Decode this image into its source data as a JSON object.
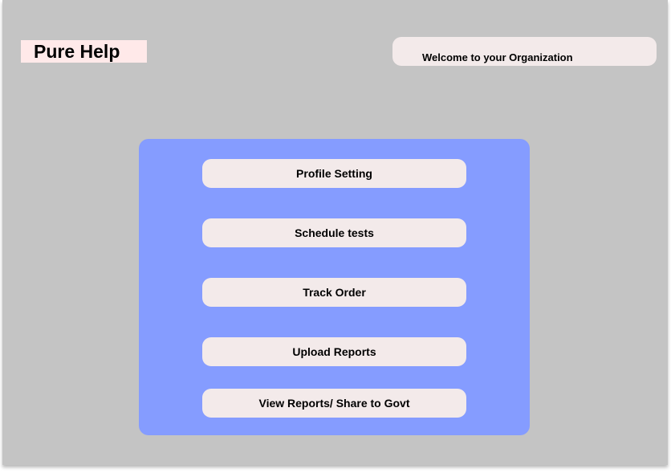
{
  "app": {
    "brand": "Pure Help",
    "welcome_text": "Welcome to your Organization"
  },
  "menu": {
    "items": [
      {
        "label": "Profile Setting"
      },
      {
        "label": "Schedule tests"
      },
      {
        "label": "Track Order"
      },
      {
        "label": "Upload Reports"
      },
      {
        "label": "View Reports/ Share to Govt"
      }
    ]
  },
  "colors": {
    "background": "#c4c4c4",
    "panel": "#859cff",
    "button": "#f3eaea",
    "logo_background": "#ffe9e9",
    "text": "#000000"
  }
}
